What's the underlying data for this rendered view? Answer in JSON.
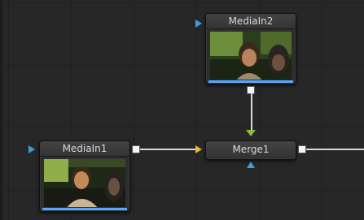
{
  "nodes": {
    "mediain2": {
      "title": "MediaIn2"
    },
    "mediain1": {
      "title": "MediaIn1"
    },
    "merge1": {
      "title": "Merge1"
    }
  },
  "colors": {
    "background": "#272727",
    "grid": "#202020",
    "input_blue": "#3a9ede",
    "foreground_yellow": "#e8b62a",
    "background_green": "#86c23a",
    "selection_bar": "#5aa6ff",
    "output_port": "#f4f4f4"
  }
}
